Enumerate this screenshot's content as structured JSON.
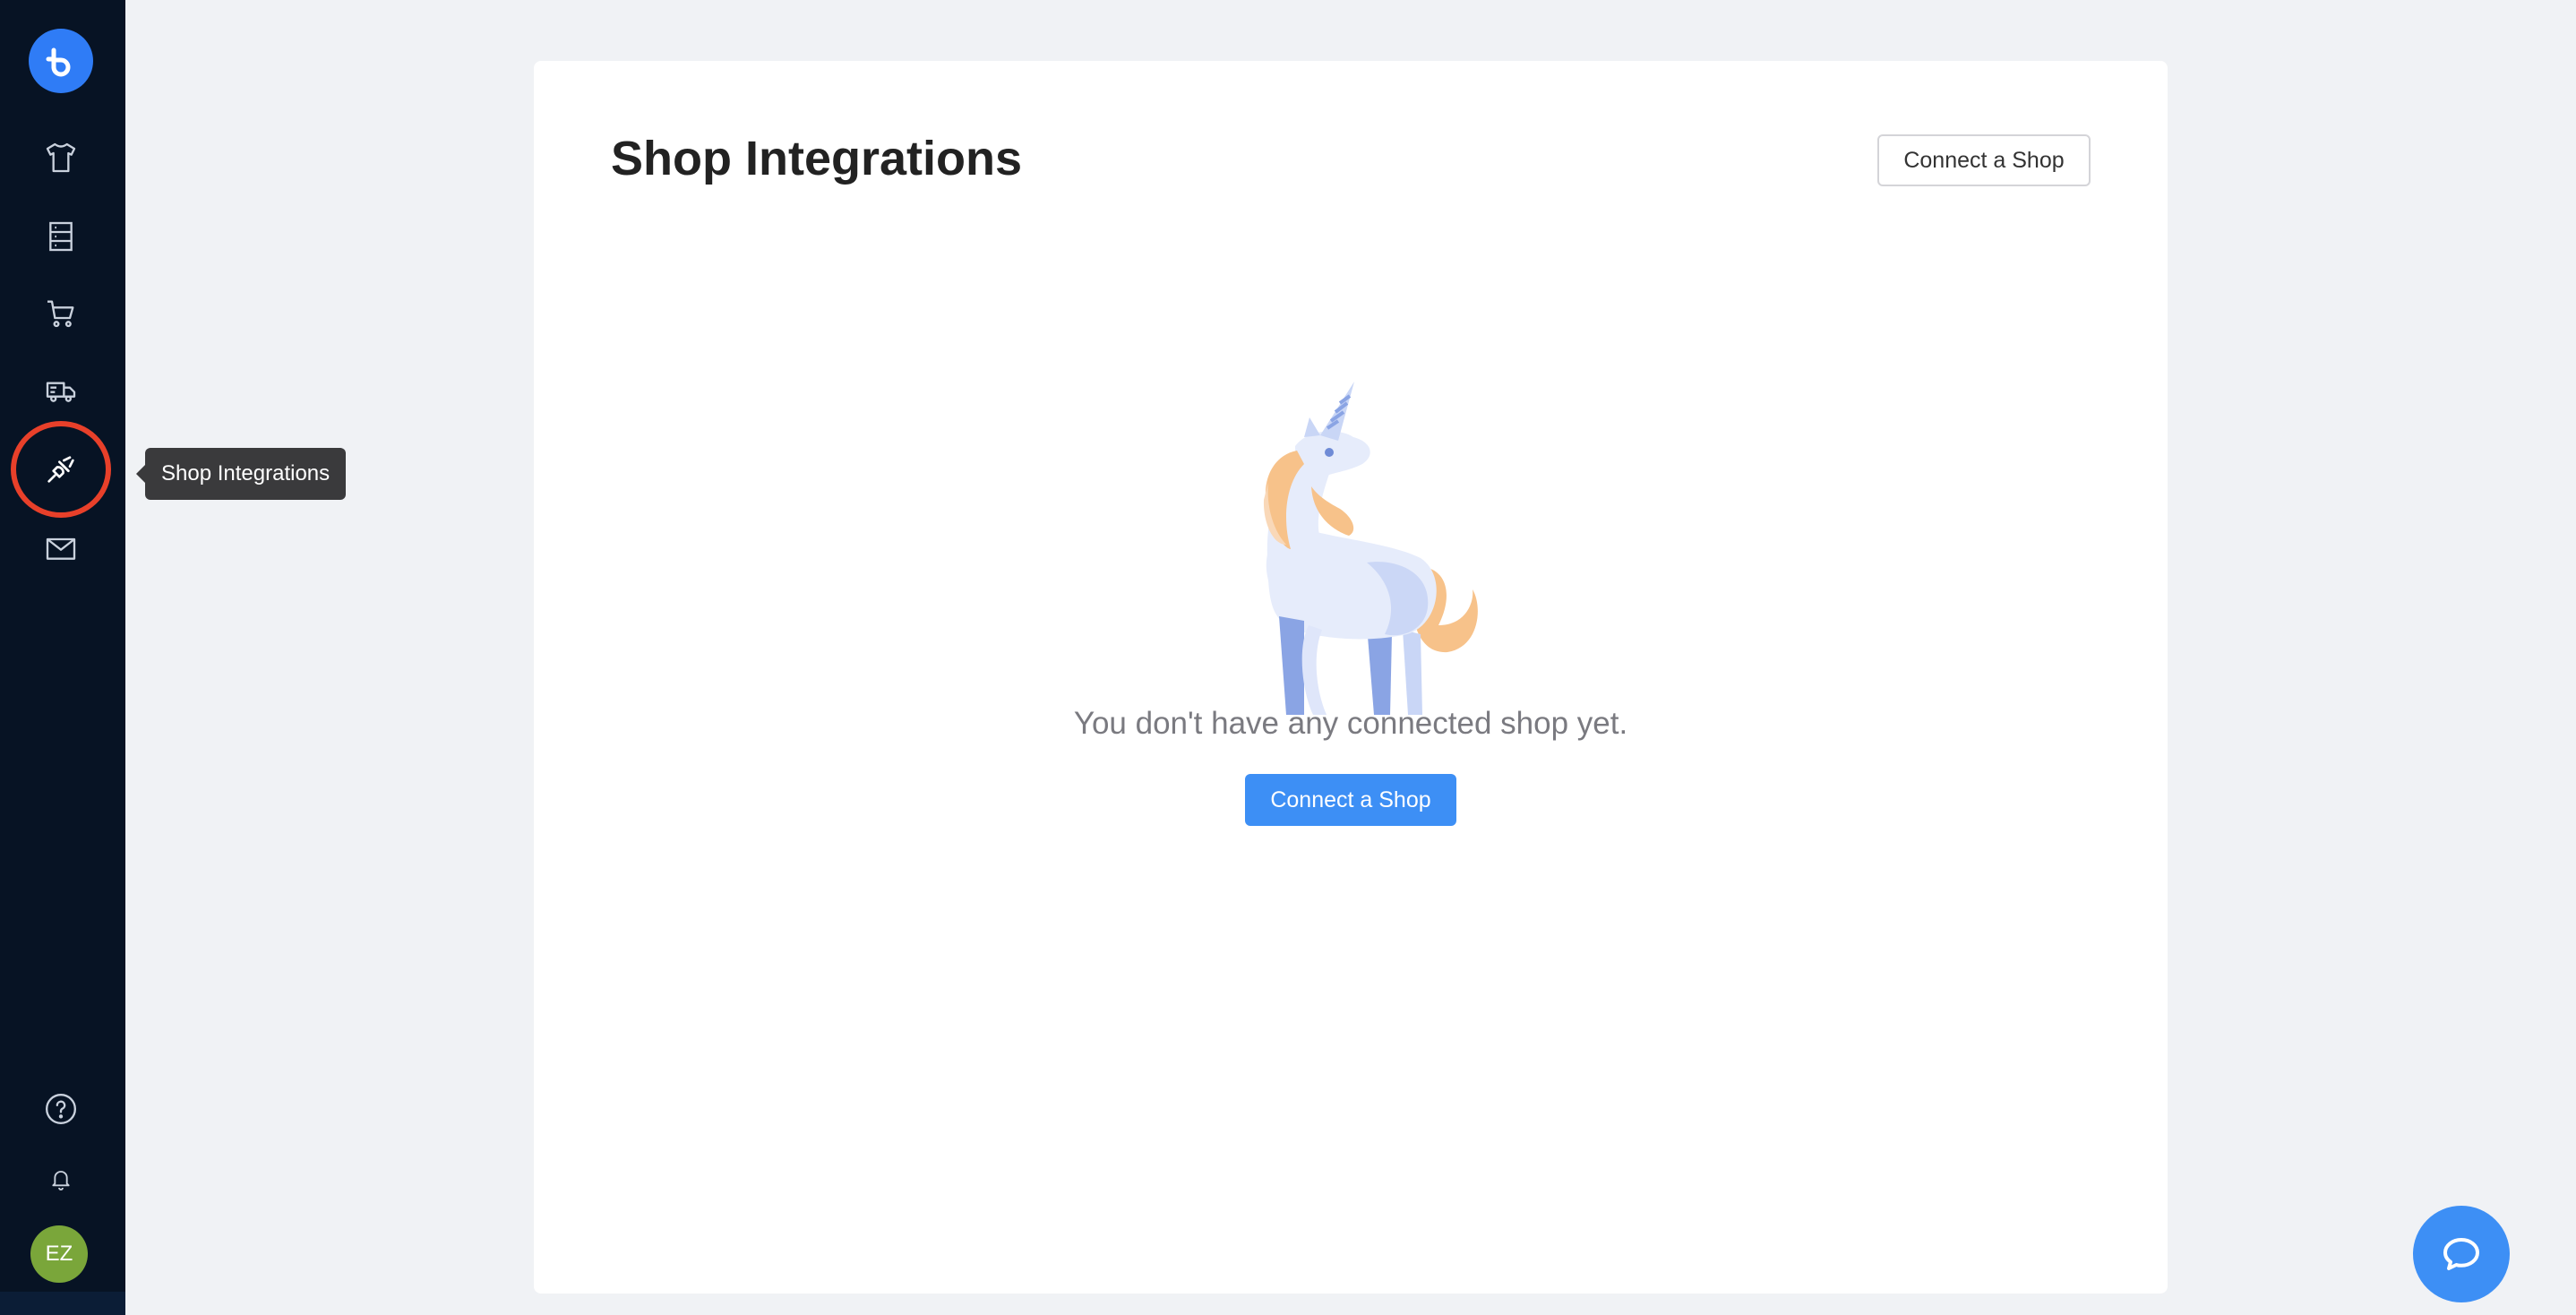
{
  "sidebar": {
    "logo_icon": "brand-logo-icon",
    "items": [
      {
        "id": "products",
        "icon": "tshirt-icon"
      },
      {
        "id": "orders",
        "icon": "list-icon"
      },
      {
        "id": "cart",
        "icon": "cart-icon"
      },
      {
        "id": "shipping",
        "icon": "truck-icon"
      },
      {
        "id": "shop-integrations",
        "icon": "plug-icon",
        "highlighted": true
      },
      {
        "id": "messages",
        "icon": "mail-icon"
      }
    ],
    "bottom_items": [
      {
        "id": "help",
        "icon": "question-icon"
      },
      {
        "id": "notifications",
        "icon": "bell-icon"
      }
    ],
    "avatar_initials": "EZ",
    "tooltip": "Shop Integrations"
  },
  "main": {
    "title": "Shop Integrations",
    "header_button_label": "Connect a Shop",
    "empty_state": {
      "illustration": "unicorn-illustration",
      "message": "You don't have any connected shop yet.",
      "button_label": "Connect a Shop"
    }
  },
  "chat": {
    "icon": "chat-bubble-icon"
  },
  "colors": {
    "sidebar_bg": "#071324",
    "accent": "#3d8ff5",
    "highlight": "#e8402a",
    "avatar": "#7aa63a"
  }
}
